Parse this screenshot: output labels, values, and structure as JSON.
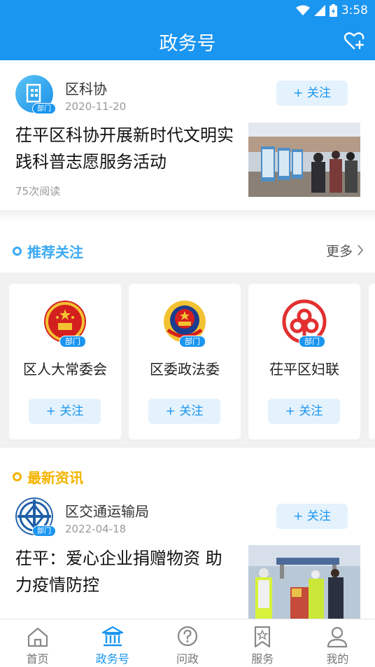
{
  "status_bar": {
    "time": "3:58"
  },
  "header": {
    "title": "政务号"
  },
  "article1": {
    "source": "区科协",
    "date": "2020-11-20",
    "badge": "部门",
    "follow": "+ 关注",
    "headline": "茌平区科协开展新时代文明实践科普志愿服务活动",
    "reads": "75次阅读"
  },
  "recommend": {
    "title": "推荐关注",
    "more": "更多",
    "cards": [
      {
        "name": "区人大常委会",
        "badge": "部门",
        "follow": "+ 关注"
      },
      {
        "name": "区委政法委",
        "badge": "部门",
        "follow": "+ 关注"
      },
      {
        "name": "茌平区妇联",
        "badge": "部门",
        "follow": "+ 关注"
      }
    ]
  },
  "news": {
    "title": "最新资讯"
  },
  "article2": {
    "source": "区交通运输局",
    "date": "2022-04-18",
    "badge": "部门",
    "follow": "+ 关注",
    "headline": "茌平：爱心企业捐赠物资 助力疫情防控"
  },
  "tabbar": {
    "items": [
      {
        "label": "首页",
        "icon": "home-icon"
      },
      {
        "label": "政务号",
        "icon": "government-building-icon"
      },
      {
        "label": "问政",
        "icon": "question-icon"
      },
      {
        "label": "服务",
        "icon": "bookmark-star-icon"
      },
      {
        "label": "我的",
        "icon": "user-icon"
      }
    ],
    "active": 1
  },
  "colors": {
    "primary": "#1a95f0",
    "news_accent": "#f4b400",
    "recommend_accent": "#3aa9f5"
  }
}
